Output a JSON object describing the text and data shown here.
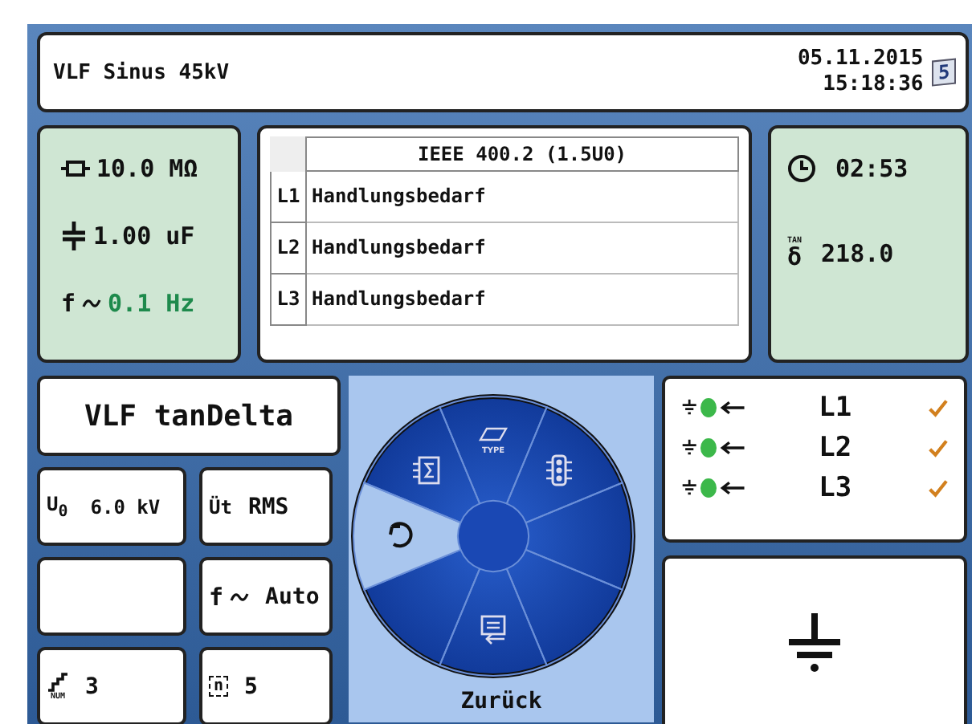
{
  "header": {
    "title": "VLF Sinus 45kV",
    "date": "05.11.2015",
    "time": "15:18:36",
    "badge": "5"
  },
  "measurements": [
    {
      "kind": "resistance",
      "value": "10.0 MΩ",
      "color": "#111111"
    },
    {
      "kind": "capacitance",
      "value": "1.00 uF",
      "color": "#111111"
    },
    {
      "kind": "frequency",
      "symbol": "f",
      "value": "0.1 Hz",
      "color": "#1e8a4c"
    }
  ],
  "assessment": {
    "standard": "IEEE 400.2 (1.5U0)",
    "rows": [
      {
        "phase": "L1",
        "result": "Handlungsbedarf"
      },
      {
        "phase": "L2",
        "result": "Handlungsbedarf"
      },
      {
        "phase": "L3",
        "result": "Handlungsbedarf"
      }
    ]
  },
  "timer": {
    "time": "02:53",
    "tan_label": "TAN",
    "symbol": "δ",
    "value": "218.0"
  },
  "mode": "VLF tanDelta",
  "settings": [
    {
      "kind": "voltage",
      "symbol": "U$_{0}$",
      "value": "6.0 kV"
    },
    {
      "kind": "waveform",
      "symbol": "Üt",
      "value": "RMS"
    },
    {
      "kind": "empty"
    },
    {
      "kind": "frequency",
      "symbol": "f",
      "value": "Auto"
    },
    {
      "kind": "steps",
      "symbol": "NUM",
      "value": "3"
    },
    {
      "kind": "cycles",
      "symbol": "n",
      "value": "5"
    }
  ],
  "wheel": {
    "segments": [
      {
        "kind": "type",
        "label": "TYPE",
        "selected": false
      },
      {
        "kind": "signal",
        "selected": false
      },
      {
        "kind": "blank",
        "selected": false
      },
      {
        "kind": "blank",
        "selected": false
      },
      {
        "kind": "export",
        "selected": false
      },
      {
        "kind": "blank",
        "selected": false
      },
      {
        "kind": "back",
        "selected": true
      },
      {
        "kind": "summary",
        "selected": false
      }
    ],
    "button": "Zurück"
  },
  "phases": [
    {
      "phase": "L1",
      "connected": true,
      "ok": true
    },
    {
      "phase": "L2",
      "connected": true,
      "ok": true
    },
    {
      "phase": "L3",
      "connected": true,
      "ok": true
    }
  ]
}
